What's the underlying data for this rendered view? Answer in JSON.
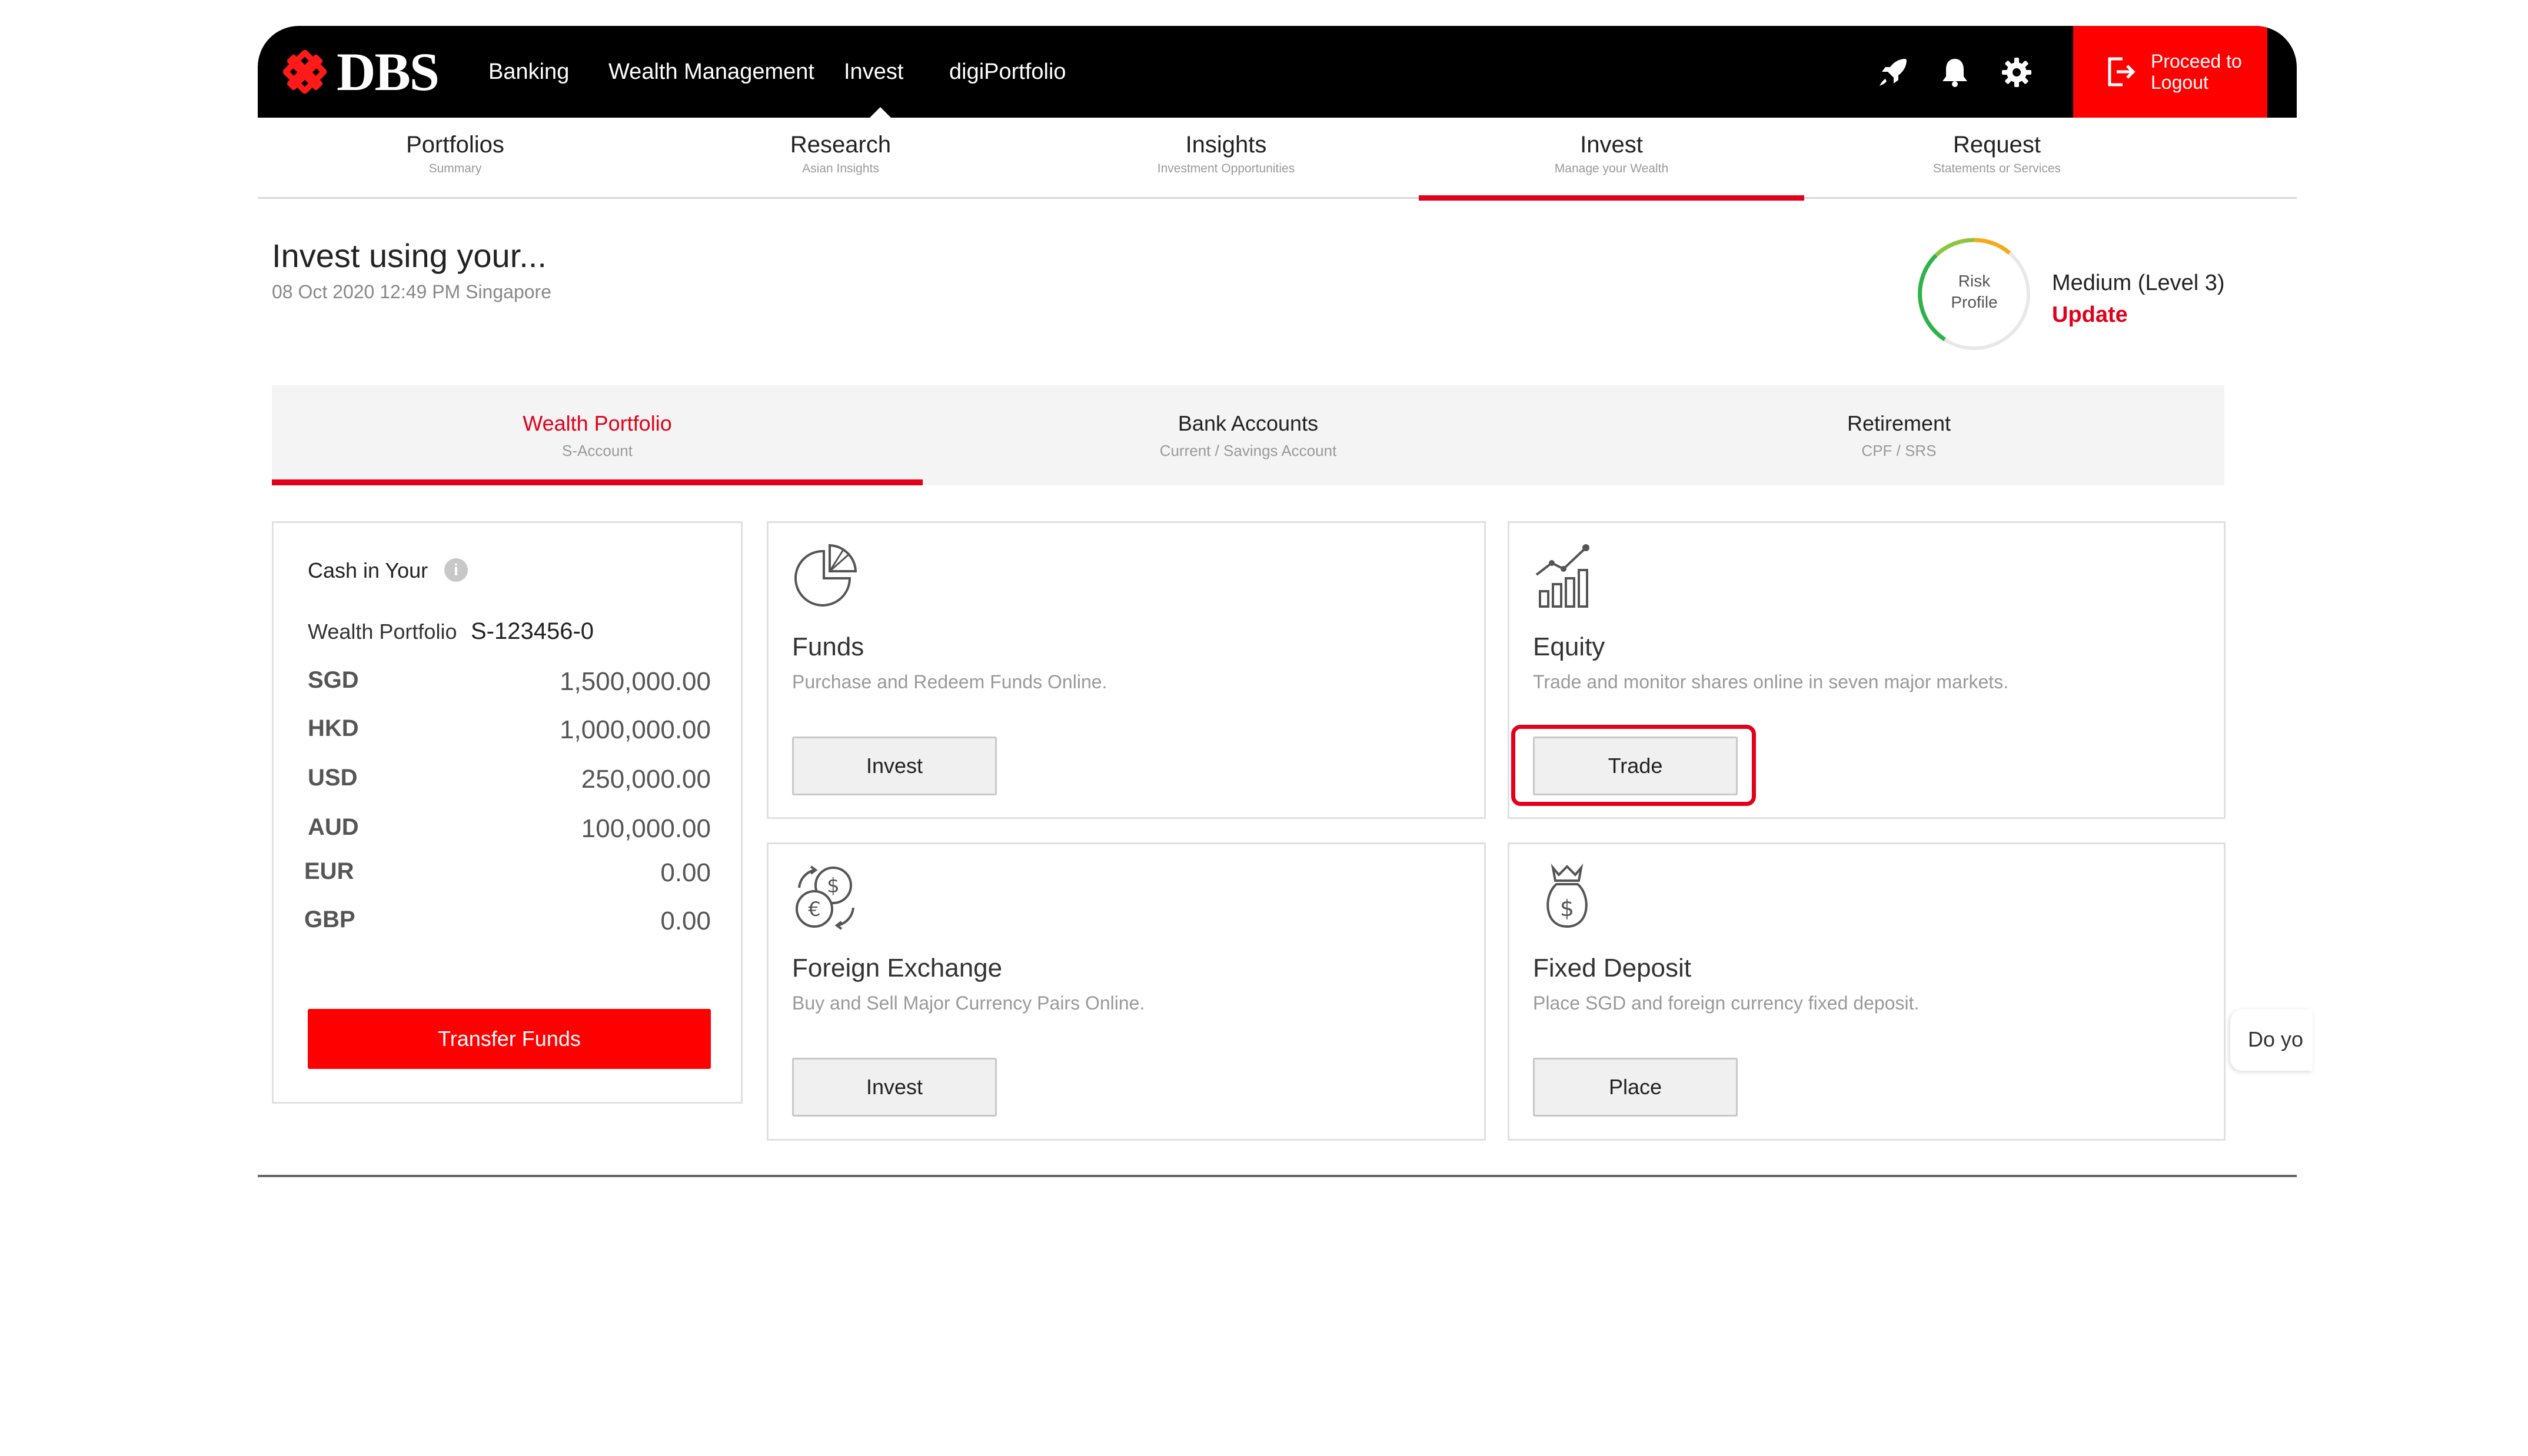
{
  "brand": {
    "name": "DBS",
    "accent": "#e2001a"
  },
  "nav": {
    "items": [
      {
        "label": "Banking"
      },
      {
        "label": "Wealth Management"
      },
      {
        "label": "Invest"
      },
      {
        "label": "digiPortfolio"
      }
    ],
    "active": "Invest",
    "icons": [
      "rocket-icon",
      "bell-icon",
      "gear-icon"
    ],
    "logout_label": "Proceed to Logout"
  },
  "section_tabs": [
    {
      "title": "Portfolios",
      "subtitle": "Summary"
    },
    {
      "title": "Research",
      "subtitle": "Asian Insights"
    },
    {
      "title": "Insights",
      "subtitle": "Investment Opportunities"
    },
    {
      "title": "Invest",
      "subtitle": "Manage your Wealth"
    },
    {
      "title": "Request",
      "subtitle": "Statements or Services"
    }
  ],
  "page": {
    "title": "Invest using your...",
    "timestamp": "08 Oct 2020 12:49 PM Singapore"
  },
  "risk": {
    "label": "Risk Profile",
    "level": "Medium (Level 3)",
    "update_label": "Update"
  },
  "account_tabs": [
    {
      "title": "Wealth Portfolio",
      "subtitle": "S-Account"
    },
    {
      "title": "Bank Accounts",
      "subtitle": "Current / Savings Account"
    },
    {
      "title": "Retirement",
      "subtitle": "CPF / SRS"
    }
  ],
  "cash": {
    "title": "Cash in Your",
    "account_label": "Wealth Portfolio",
    "account_number": "S-123456-0",
    "balances": [
      {
        "code": "SGD",
        "amount": "1,500,000.00"
      },
      {
        "code": "HKD",
        "amount": "1,000,000.00"
      },
      {
        "code": "USD",
        "amount": "250,000.00"
      },
      {
        "code": "AUD",
        "amount": "100,000.00"
      },
      {
        "code": "EUR",
        "amount": "0.00"
      },
      {
        "code": "GBP",
        "amount": "0.00"
      }
    ],
    "transfer_label": "Transfer Funds"
  },
  "products": {
    "funds": {
      "title": "Funds",
      "desc": "Purchase and Redeem Funds Online.",
      "button": "Invest",
      "icon": "pie-chart-icon"
    },
    "equity": {
      "title": "Equity",
      "desc": "Trade and monitor shares online in seven major markets.",
      "button": "Trade",
      "icon": "bar-chart-icon"
    },
    "fx": {
      "title": "Foreign Exchange",
      "desc": "Buy and Sell Major Currency Pairs Online.",
      "button": "Invest",
      "icon": "currency-exchange-icon"
    },
    "fd": {
      "title": "Fixed Deposit",
      "desc": "Place SGD and foreign currency fixed deposit.",
      "button": "Place",
      "icon": "money-bag-icon"
    }
  },
  "chat": {
    "text": "Do yo"
  }
}
